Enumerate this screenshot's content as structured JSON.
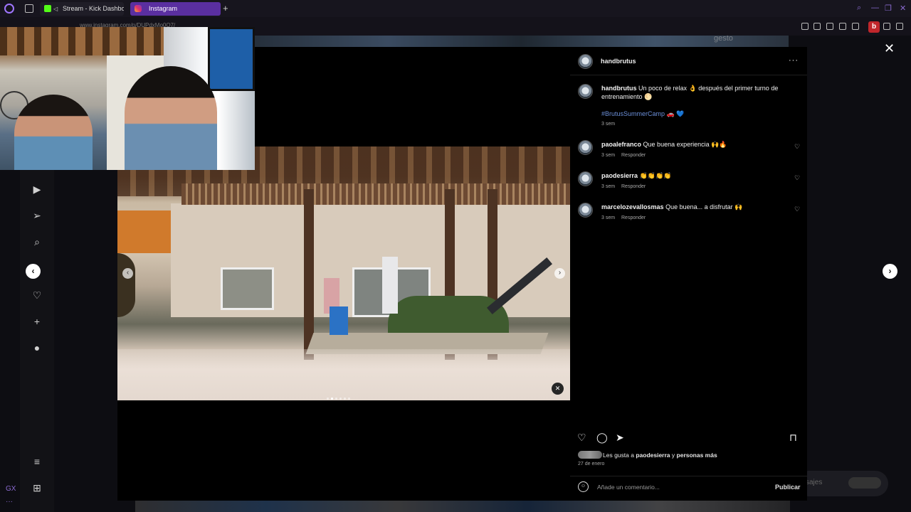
{
  "browser": {
    "tabs": [
      {
        "label": "Stream - Kick Dashboa",
        "active": false
      },
      {
        "label": "Instagram",
        "active": true
      }
    ],
    "new_tab": "+",
    "url": "www.instagram.com/p/DUPdxMo0Q7/",
    "profile_letter": "b",
    "accent": "#5a2fa0"
  },
  "background": {
    "brand_text": "gesto",
    "messages_label": "sajes"
  },
  "post": {
    "author": "handbrutus",
    "more_label": "···",
    "caption": {
      "user": "handbrutus",
      "text": "Un poco de relax 👌 después del primer turno de entrenamiento 🌕",
      "hashtag": "#BrutusSummerCamp",
      "emoji_after_tag": "🚗 💙",
      "time": "3 sem"
    },
    "comments": [
      {
        "user": "paoalefranco",
        "text": "Que buena experiencia 🙌🔥",
        "time": "3 sem",
        "reply": "Responder"
      },
      {
        "user": "paodesierra",
        "text": "👏👏👏👏",
        "time": "3 sem",
        "reply": "Responder"
      },
      {
        "user": "marcelozevallosmas",
        "text": "Que buena... a disfrutar 🙌",
        "time": "3 sem",
        "reply": "Responder"
      }
    ],
    "likes": {
      "prefix": "Les gusta a",
      "user": "paodesierra",
      "connector": "y",
      "rest": "personas más"
    },
    "date": "27 de enero",
    "comment_placeholder": "Añade un comentario...",
    "publish_label": "Publicar",
    "carousel": {
      "slides": 6,
      "current": 2
    }
  },
  "icons": {
    "close": "✕",
    "prev": "‹",
    "next": "›",
    "heart": "♡",
    "comment": "◯",
    "share": "➤",
    "save": "⊓",
    "emoji": "☺",
    "mute": "✕"
  }
}
